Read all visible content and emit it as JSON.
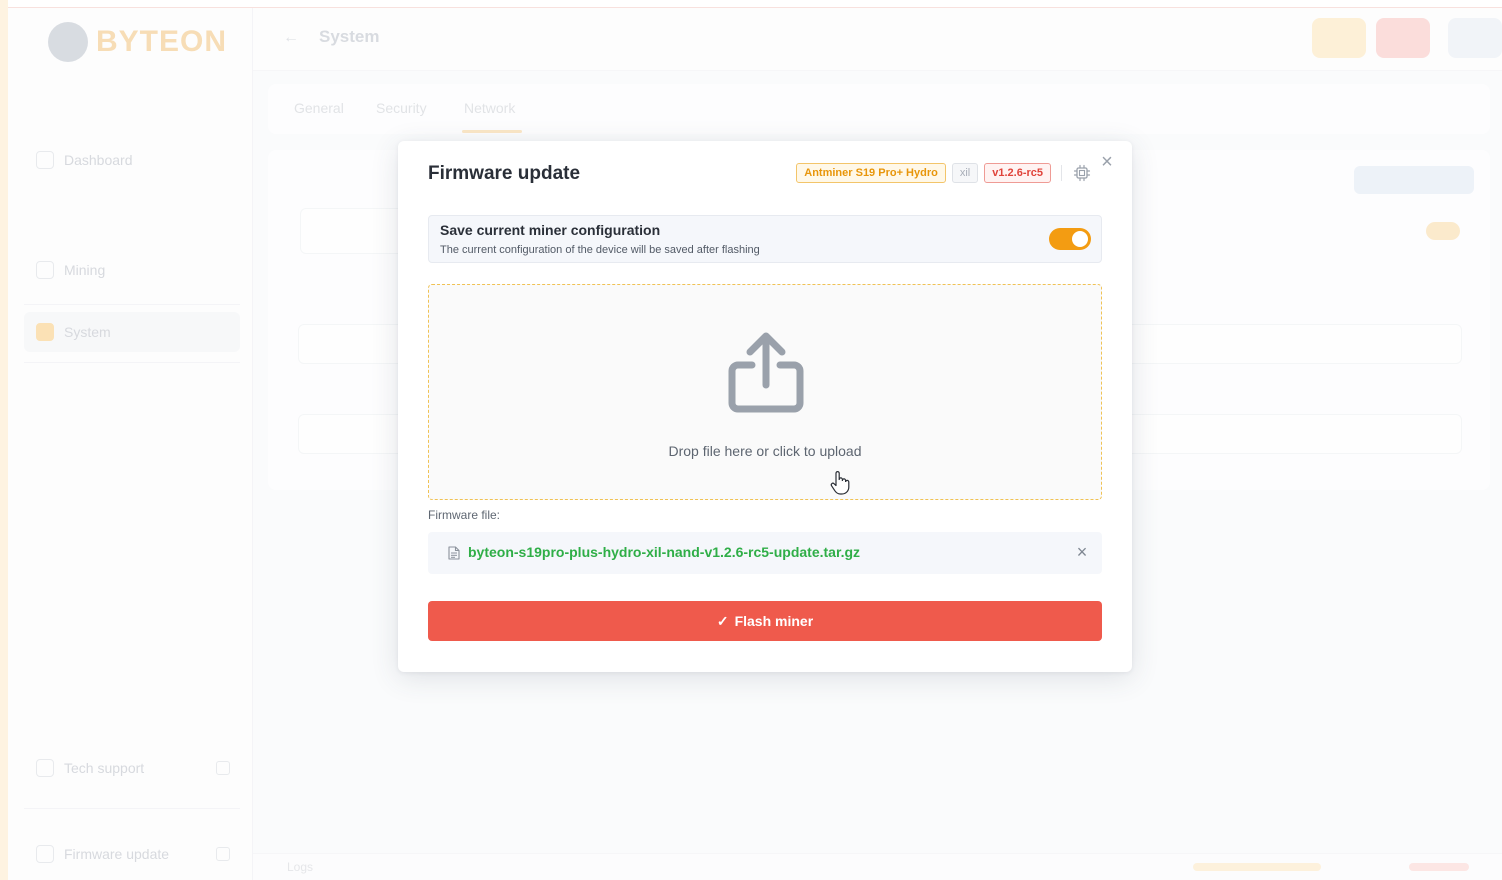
{
  "app": {
    "logo_text": "BYTEON",
    "header_title": "System",
    "sidebar": {
      "items": [
        {
          "label": "Dashboard"
        },
        {
          "label": "Mining"
        },
        {
          "label": "System"
        },
        {
          "label": "Tech support"
        },
        {
          "label": "Firmware update"
        }
      ]
    },
    "tabs": [
      "General",
      "Security",
      "Network"
    ],
    "footer_text": "Logs"
  },
  "modal": {
    "title": "Firmware update",
    "tags": {
      "model": "Antminer S19 Pro+ Hydro",
      "arch": "xil",
      "version": "v1.2.6-rc5"
    },
    "close_label": "×",
    "save_config": {
      "title": "Save current miner configuration",
      "description": "The current configuration of the device will be saved after flashing",
      "enabled": true
    },
    "dropzone": {
      "text": "Drop file here or click to upload"
    },
    "firmware_file": {
      "label": "Firmware file:",
      "name": "byteon-s19pro-plus-hydro-xil-nand-v1.2.6-rc5-update.tar.gz",
      "remove_label": "×"
    },
    "flash_button": {
      "check": "✓",
      "label": "Flash miner"
    }
  },
  "colors": {
    "accent_orange": "#f39c12",
    "flash_red": "#ef5a4c",
    "file_green": "#2fae47",
    "version_red": "#e0433a"
  }
}
